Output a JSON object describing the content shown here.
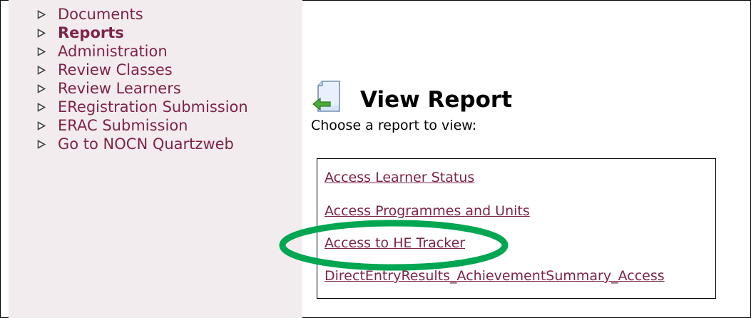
{
  "nav": {
    "items": [
      {
        "label": "Documents",
        "active": false
      },
      {
        "label": "Reports",
        "active": true
      },
      {
        "label": "Administration",
        "active": false
      },
      {
        "label": "Review Classes",
        "active": false
      },
      {
        "label": "Review Learners",
        "active": false
      },
      {
        "label": "ERegistration Submission",
        "active": false
      },
      {
        "label": "ERAC Submission",
        "active": false
      },
      {
        "label": "Go to NOCN Quartzweb",
        "active": false
      }
    ]
  },
  "main": {
    "title": "View Report",
    "subtitle": "Choose a report to view:",
    "reports": [
      "Access Learner Status",
      "Access Programmes and Units",
      "Access to HE Tracker",
      "DirectEntryResults_AchievementSummary_Access"
    ]
  },
  "colors": {
    "sidebar_bg": "#f3ecef",
    "link": "#7d2448",
    "highlight_annotation": "#00a651"
  },
  "icons": {
    "nav_bullet": "triangle-right-icon",
    "title": "report-document-icon"
  }
}
